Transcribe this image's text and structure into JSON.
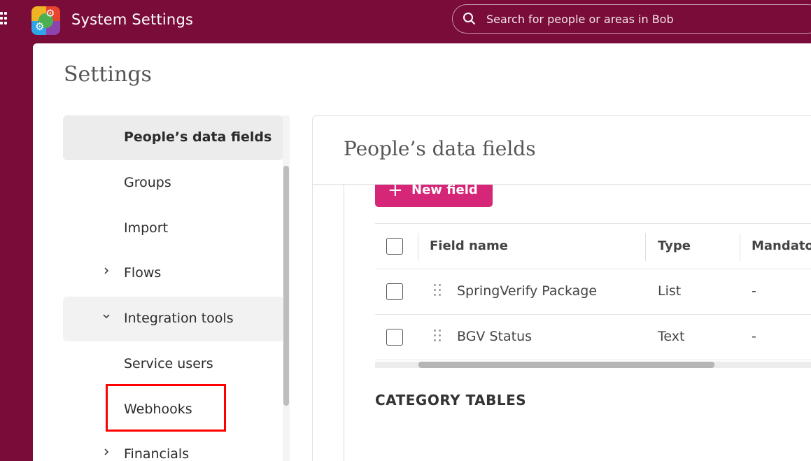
{
  "header": {
    "app_title": "System Settings",
    "search_placeholder": "Search for people or areas in Bob"
  },
  "page": {
    "title": "Settings"
  },
  "sidebar": {
    "items": [
      {
        "label": "People’s data fields",
        "state": "active"
      },
      {
        "label": "Groups"
      },
      {
        "label": "Import"
      },
      {
        "label": "Flows",
        "chevron": "chevron-right-icon"
      },
      {
        "label": "Integration tools",
        "chevron": "chevron-down-icon",
        "state": "expanded"
      },
      {
        "label": "Service users"
      },
      {
        "label": "Webhooks",
        "highlighted": true
      },
      {
        "label": "Financials",
        "chevron": "chevron-right-icon"
      }
    ]
  },
  "content": {
    "title": "People’s data fields",
    "new_field_label": "New field",
    "table": {
      "columns": [
        "Field name",
        "Type",
        "Mandato"
      ],
      "rows": [
        {
          "field_name": "SpringVerify Package",
          "type": "List",
          "mandatory": "-"
        },
        {
          "field_name": "BGV Status",
          "type": "Text",
          "mandatory": "-"
        }
      ]
    },
    "category_tables_title": "CATEGORY TABLES"
  },
  "colors": {
    "brand": "#7a0c3a",
    "accent": "#d52677",
    "highlight_box": "#ff0000"
  }
}
